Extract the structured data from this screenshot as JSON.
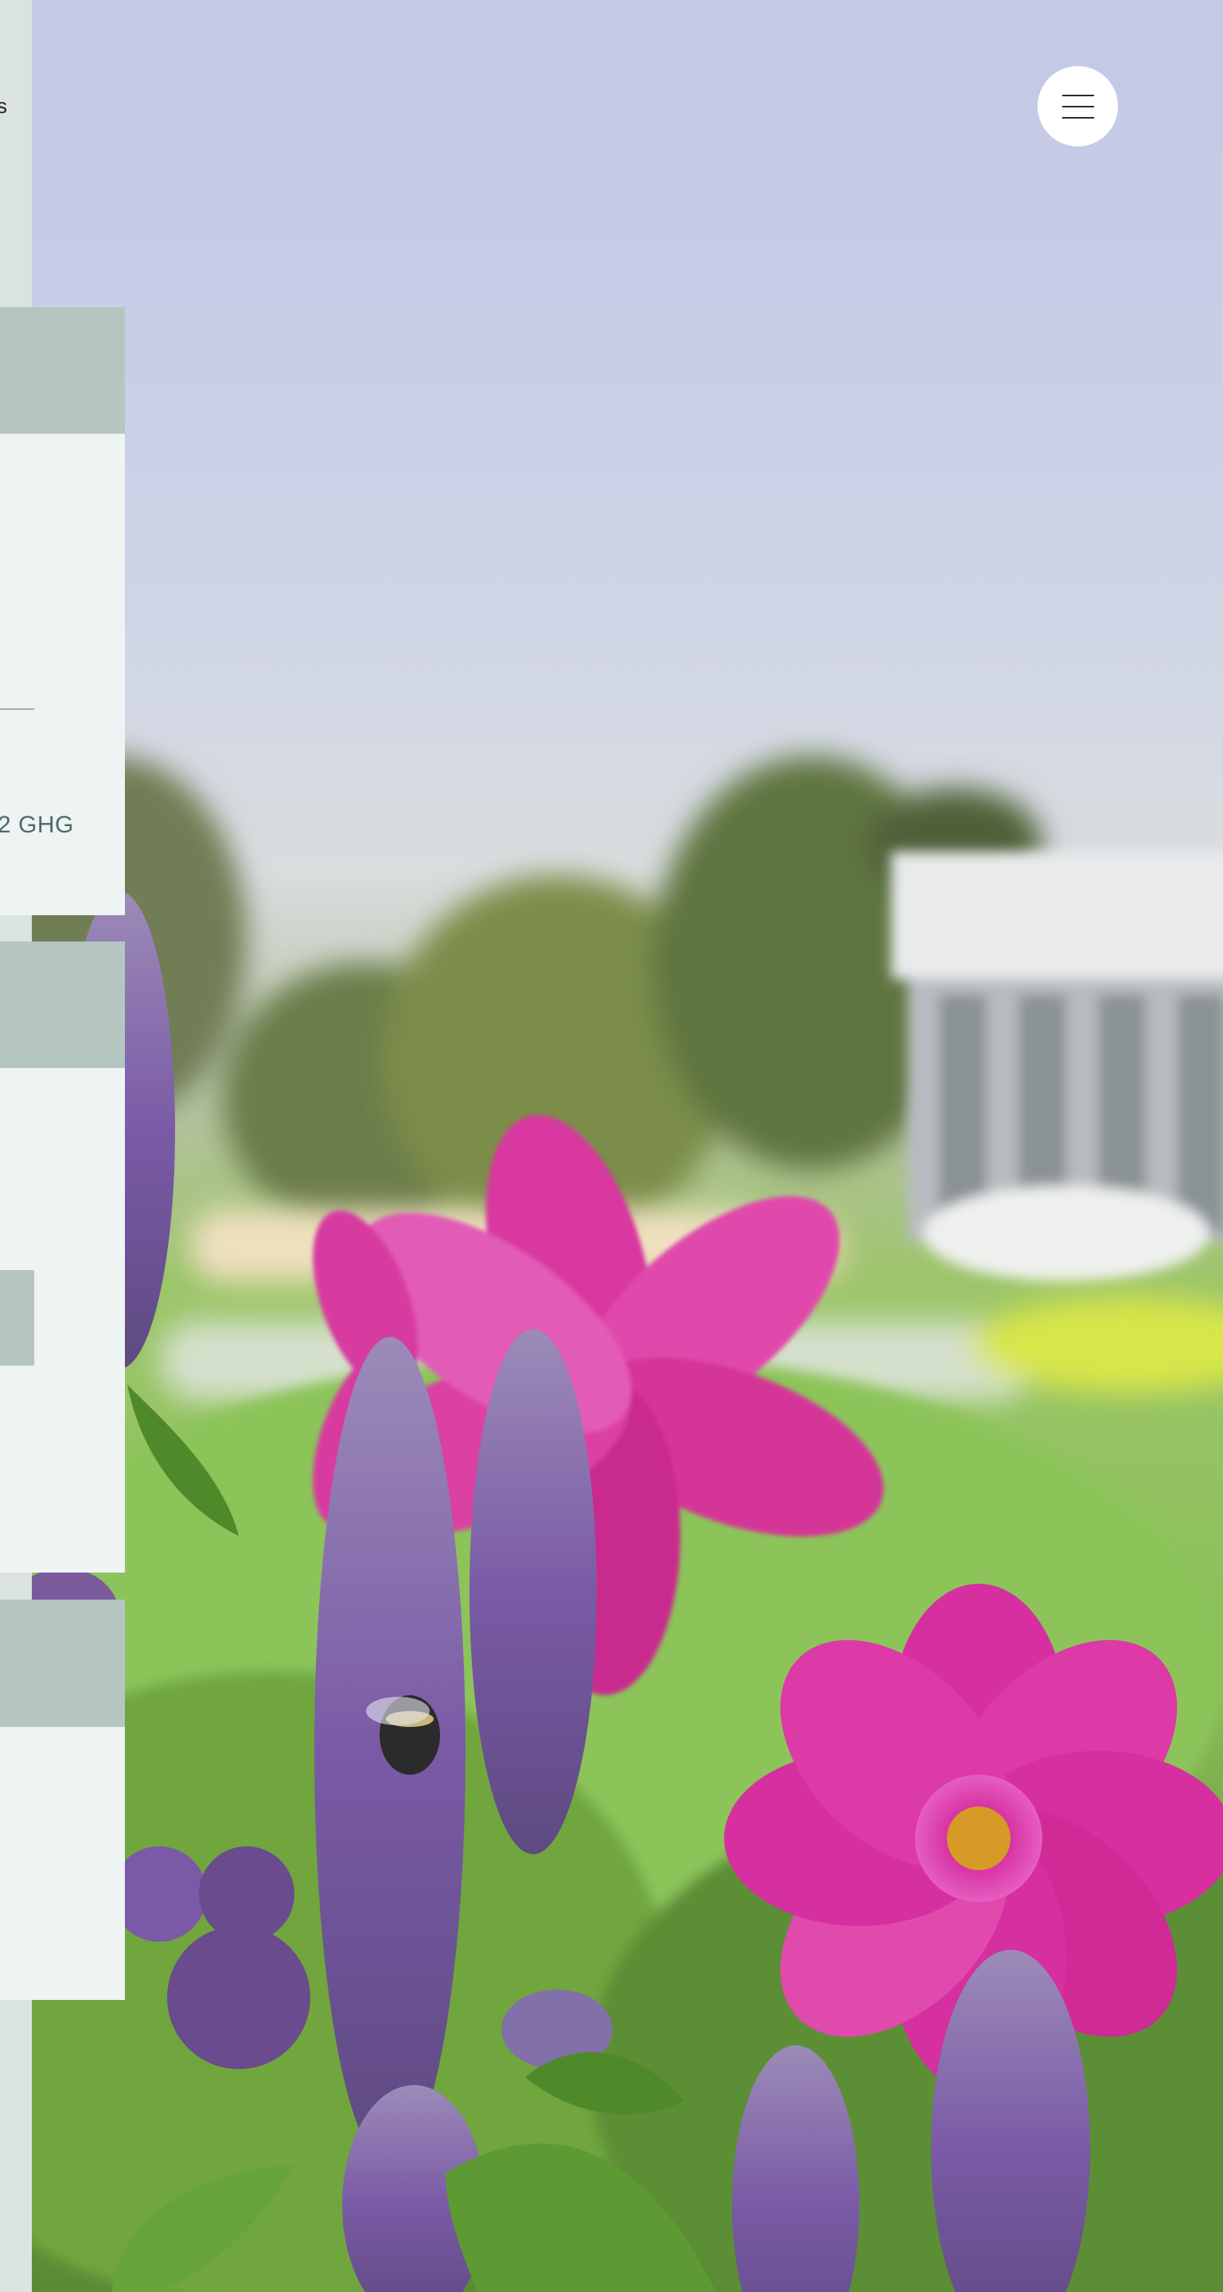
{
  "sidebar": {
    "partial_label": "s"
  },
  "cards": [
    {
      "stat_text": "2 GHG"
    },
    {
      "button_label": ""
    },
    {}
  ],
  "menu": {
    "icon": "hamburger-menu-icon"
  },
  "background": {
    "subject": "flower-field-photo",
    "colors": {
      "sky": "#c6cce6",
      "foliage": "#8cc15a",
      "flower_magenta": "#d6309e",
      "flower_purple": "#7a5aa6"
    }
  },
  "theme": {
    "card_bg": "#eef3f3",
    "card_header_bg": "#b5c6c2",
    "stat_color": "#4d6c66"
  }
}
